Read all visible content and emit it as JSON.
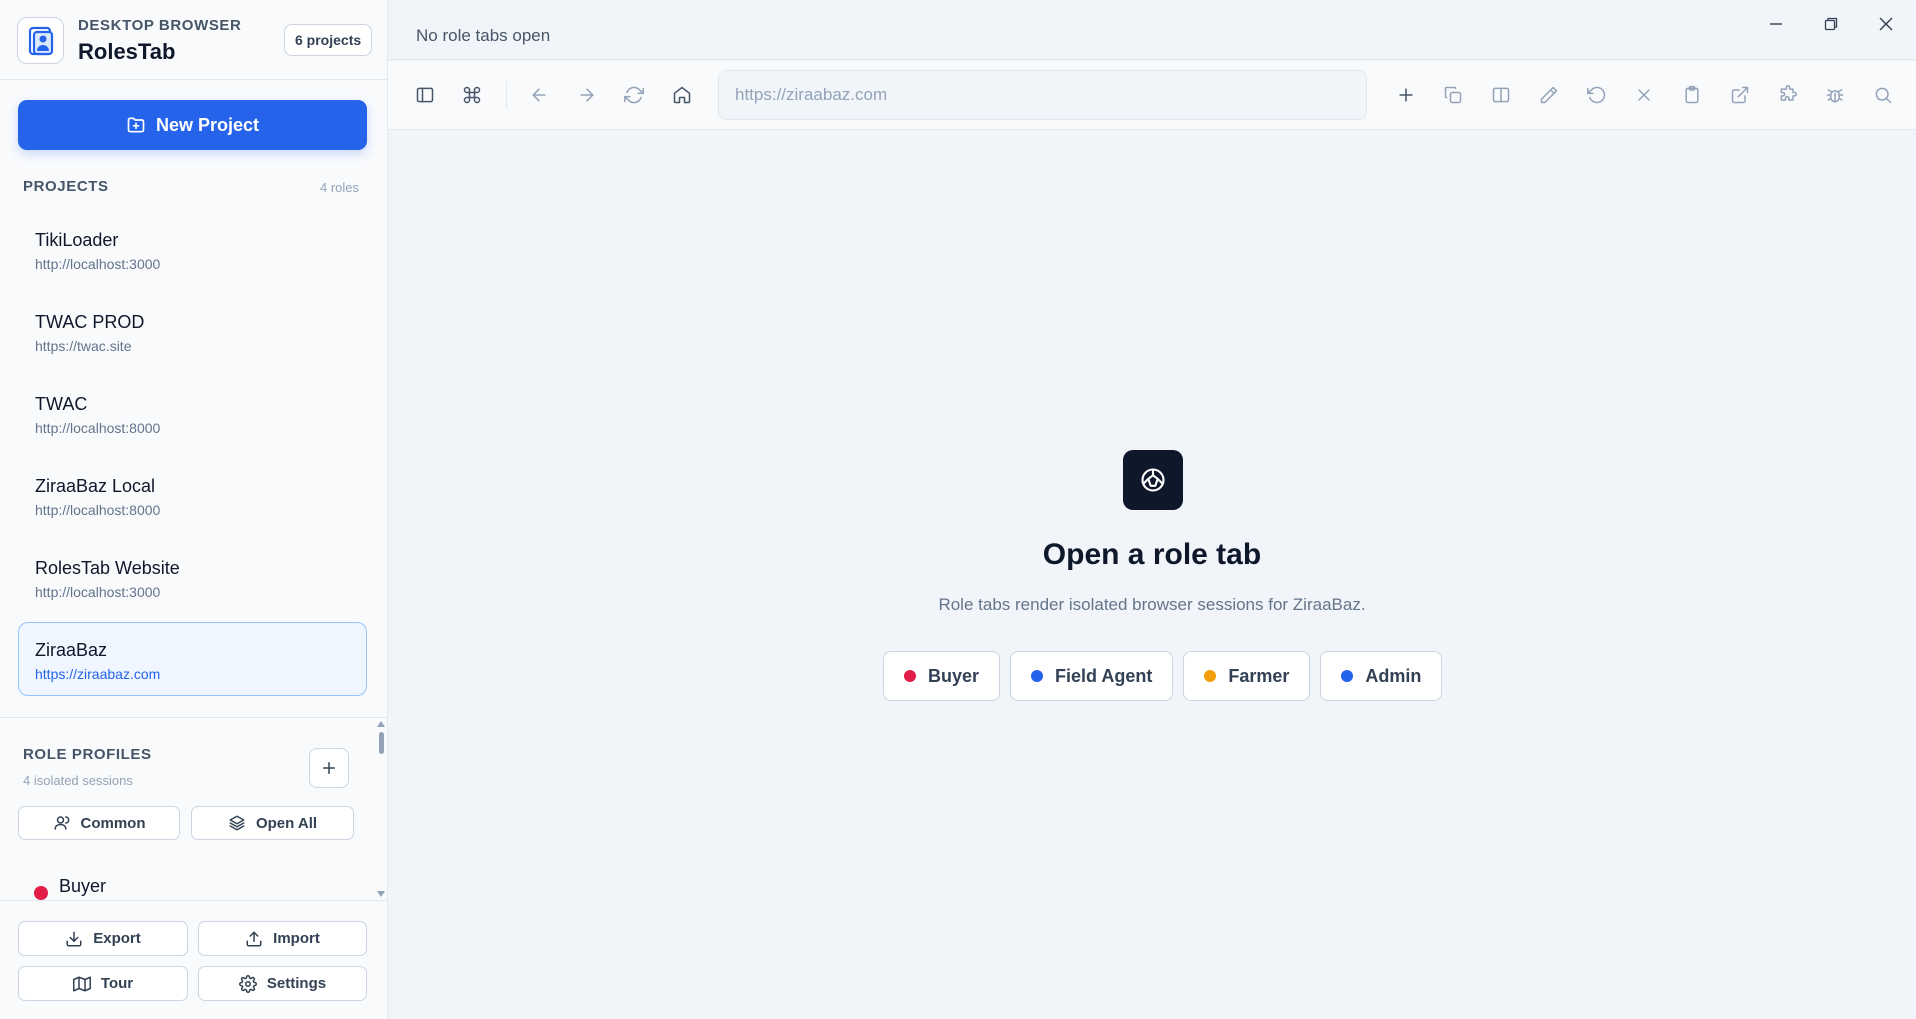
{
  "brand": {
    "kicker": "DESKTOP BROWSER",
    "name": "RolesTab",
    "count_badge": "6 projects",
    "logo_icon": "user-card-icon"
  },
  "new_project_label": "New Project",
  "projects_section": {
    "title": "PROJECTS",
    "meta": "4 roles"
  },
  "projects": [
    {
      "name": "TikiLoader",
      "url": "http://localhost:3000",
      "active": false
    },
    {
      "name": "TWAC PROD",
      "url": "https://twac.site",
      "active": false
    },
    {
      "name": "TWAC",
      "url": "http://localhost:8000",
      "active": false
    },
    {
      "name": "ZiraaBaz Local",
      "url": "http://localhost:8000",
      "active": false
    },
    {
      "name": "RolesTab Website",
      "url": "http://localhost:3000",
      "active": false
    },
    {
      "name": "ZiraaBaz",
      "url": "https://ziraabaz.com",
      "active": true
    }
  ],
  "role_profiles": {
    "title": "ROLE PROFILES",
    "meta": "4 isolated sessions",
    "common_label": "Common",
    "open_all_label": "Open All",
    "first_role": {
      "name": "Buyer",
      "color": "#e11d48"
    }
  },
  "footer": {
    "export_label": "Export",
    "import_label": "Import",
    "tour_label": "Tour",
    "settings_label": "Settings"
  },
  "titlebar": {
    "title": "No role tabs open"
  },
  "toolbar": {
    "url_placeholder": "https://ziraabaz.com"
  },
  "empty_state": {
    "title": "Open a role tab",
    "subtitle": "Role tabs render isolated browser sessions for ZiraaBaz.",
    "roles": [
      {
        "name": "Buyer",
        "color": "#e11d48"
      },
      {
        "name": "Field Agent",
        "color": "#2563eb"
      },
      {
        "name": "Farmer",
        "color": "#f59e0b"
      },
      {
        "name": "Admin",
        "color": "#2563eb"
      }
    ]
  },
  "colors": {
    "accent": "#2563eb",
    "text": "#0f172a",
    "muted": "#64748b"
  }
}
